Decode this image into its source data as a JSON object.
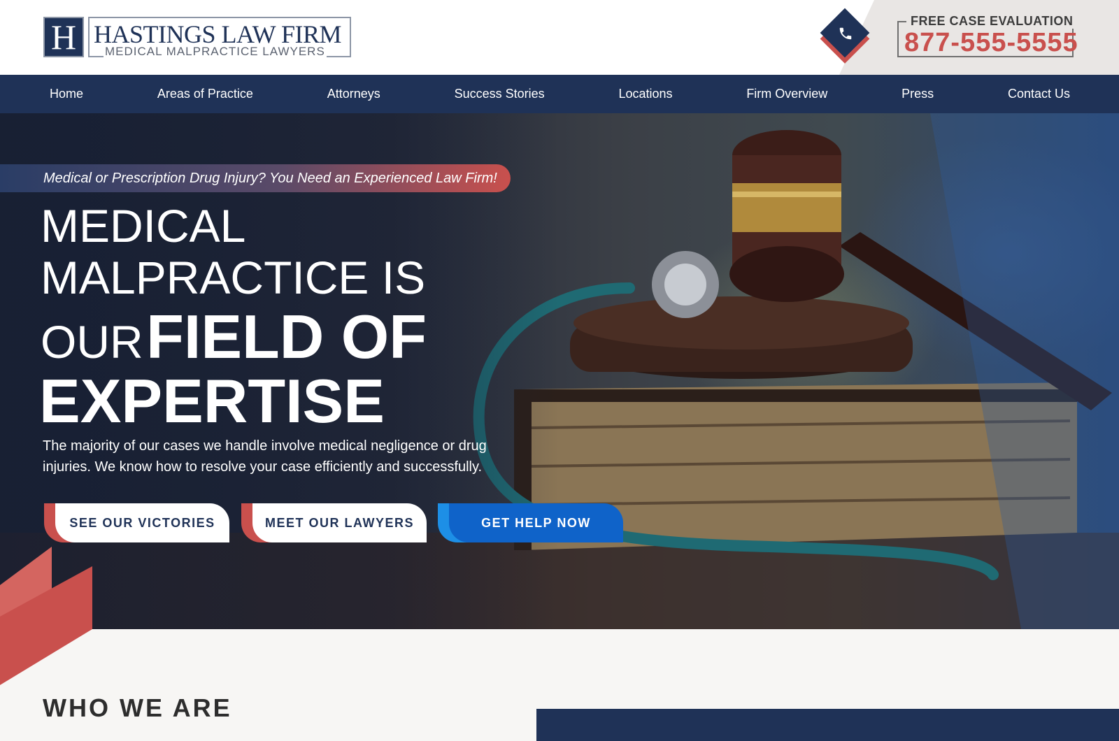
{
  "header": {
    "logo_letter": "H",
    "firm_name": "HASTINGS LAW FIRM",
    "firm_tagline": "MEDICAL MALPRACTICE LAWYERS",
    "cta_label": "FREE CASE EVALUATION",
    "phone": "877-555-5555",
    "phone_icon": "phone-icon"
  },
  "nav": {
    "items": [
      {
        "label": "Home"
      },
      {
        "label": "Areas of Practice"
      },
      {
        "label": "Attorneys"
      },
      {
        "label": "Success Stories"
      },
      {
        "label": "Locations"
      },
      {
        "label": "Firm Overview"
      },
      {
        "label": "Press"
      },
      {
        "label": "Contact Us"
      }
    ]
  },
  "hero": {
    "tagline": "Medical or Prescription Drug Injury? You Need an Experienced Law Firm!",
    "headline_line1": "MEDICAL",
    "headline_line2": "MALPRACTICE IS",
    "headline_line3_light": "OUR",
    "headline_line3_bold": "FIELD OF",
    "headline_line4": "EXPERTISE",
    "body": "The majority of our cases we handle involve medical negligence or drug injuries. We know how to resolve your case efficiently and successfully.",
    "buttons": [
      {
        "label": "SEE OUR VICTORIES"
      },
      {
        "label": "MEET OUR LAWYERS"
      },
      {
        "label": "GET HELP NOW"
      }
    ]
  },
  "who": {
    "title": "WHO WE ARE"
  },
  "colors": {
    "navy": "#1f3257",
    "red": "#c9504d",
    "blue": "#0f63c9",
    "light_gray": "#e9e6e4"
  }
}
